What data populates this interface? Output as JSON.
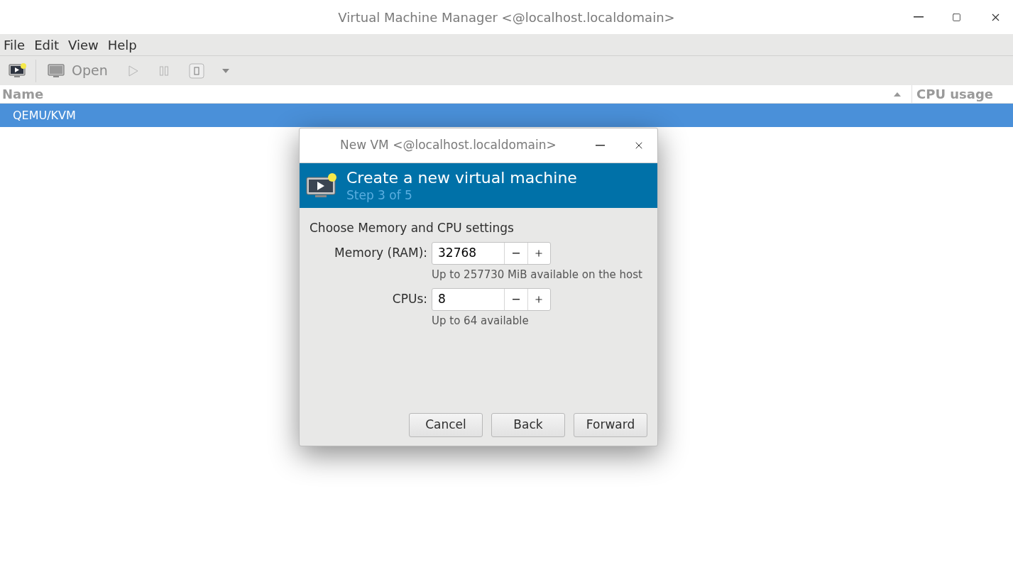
{
  "window": {
    "title": "Virtual Machine Manager <@localhost.localdomain>"
  },
  "menu": [
    "File",
    "Edit",
    "View",
    "Help"
  ],
  "toolbar": [
    {
      "kind": "new",
      "disabled": false
    },
    {
      "kind": "open",
      "label": "Open",
      "disabled": true
    },
    {
      "kind": "run",
      "disabled": true
    },
    {
      "kind": "pause",
      "disabled": true
    },
    {
      "kind": "shutdown",
      "disabled": true
    },
    {
      "kind": "menu",
      "disabled": true
    }
  ],
  "table": {
    "columns": [
      "Name",
      "CPU usage"
    ],
    "rows": [
      {
        "name": "QEMU/KVM",
        "selected": true
      }
    ]
  },
  "dialog": {
    "title": "New VM <@localhost.localdomain>",
    "header": {
      "title": "Create a new virtual machine",
      "step": "Step 3 of 5"
    },
    "heading": "Choose Memory and CPU settings",
    "fields": [
      {
        "label": "Memory (RAM):",
        "value": "32768",
        "hint": "Up to 257730 MiB available on the host"
      },
      {
        "label": "CPUs:",
        "value": "8",
        "hint": "Up to 64 available"
      }
    ],
    "buttons": [
      "Cancel",
      "Back",
      "Forward"
    ]
  }
}
